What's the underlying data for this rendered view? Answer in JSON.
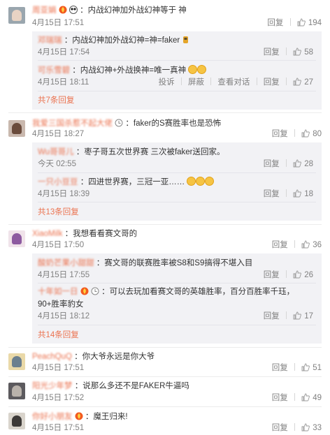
{
  "ui": {
    "reply_label": "回复",
    "report_label": "投诉",
    "block_label": "屏蔽",
    "view_dialog_label": "查看对话"
  },
  "comments": [
    {
      "username": "周亚娟",
      "separator": "：",
      "text": "内战幻神加外战幻神等于 神",
      "time": "4月15日 17:51",
      "likes": "194",
      "replies": [
        {
          "username": "邓瑞瑞",
          "separator": "：",
          "text": "内战幻神加外战幻神=神=faker",
          "time": "4月15日 17:54",
          "likes": "58"
        },
        {
          "username": "可乐雪碧",
          "separator": "：",
          "text": "内战幻神+外战换神=唯一真神",
          "time": "4月15日 18:11",
          "likes": "27"
        }
      ],
      "more": "共7条回复"
    },
    {
      "username": "我爱三国杀惹不起大佬",
      "separator": "：",
      "text": "faker的S赛胜率也是恐怖",
      "time": "4月15日 18:27",
      "likes": "80",
      "replies": [
        {
          "username": "Wu哥哥儿",
          "separator": "：",
          "text": "枣子哥五次世界赛 三次被faker送回家。",
          "time": "今天 02:55",
          "likes": "28"
        },
        {
          "username": "一只小豆豆",
          "separator": "：",
          "text": "四进世界赛，三冠一亚……",
          "time": "4月15日 18:39",
          "likes": "18"
        }
      ],
      "more": "共13条回复"
    },
    {
      "username": "XiaoMilk",
      "separator": "：",
      "text": "我想看看赛文哥的",
      "time": "4月15日 17:50",
      "likes": "36",
      "replies": [
        {
          "username": "酸奶芒果小甜甜",
          "separator": "：",
          "text": "赛文哥的联赛胜率被S8和S9搞得不堪入目",
          "time": "4月15日 17:55",
          "likes": "26"
        },
        {
          "username": "十年如一日",
          "separator": "：",
          "text": "可以去玩加看赛文哥的英雄胜率，百分百胜率千珏，",
          "text2": "90+胜率豹女",
          "time": "4月15日 18:12",
          "likes": "17"
        }
      ],
      "more": "共14条回复"
    },
    {
      "username": "PeachQuQ",
      "separator": "：",
      "text": "你大爷永远是你大爷",
      "time": "4月15日 17:51",
      "likes": "51"
    },
    {
      "username": "阳光少年梦",
      "separator": "：",
      "text": "说那么多还不是FAKER牛逼吗",
      "time": "4月15日 17:52",
      "likes": "49"
    },
    {
      "username": "你好小朋友",
      "separator": "：",
      "text": "魔王归来!",
      "time": "4月15日 17:51",
      "likes": "33"
    }
  ],
  "colors": {
    "username": "#eb7350",
    "link": "#eb7350",
    "meta": "#808080",
    "reply_bg": "#f2f2f5"
  }
}
